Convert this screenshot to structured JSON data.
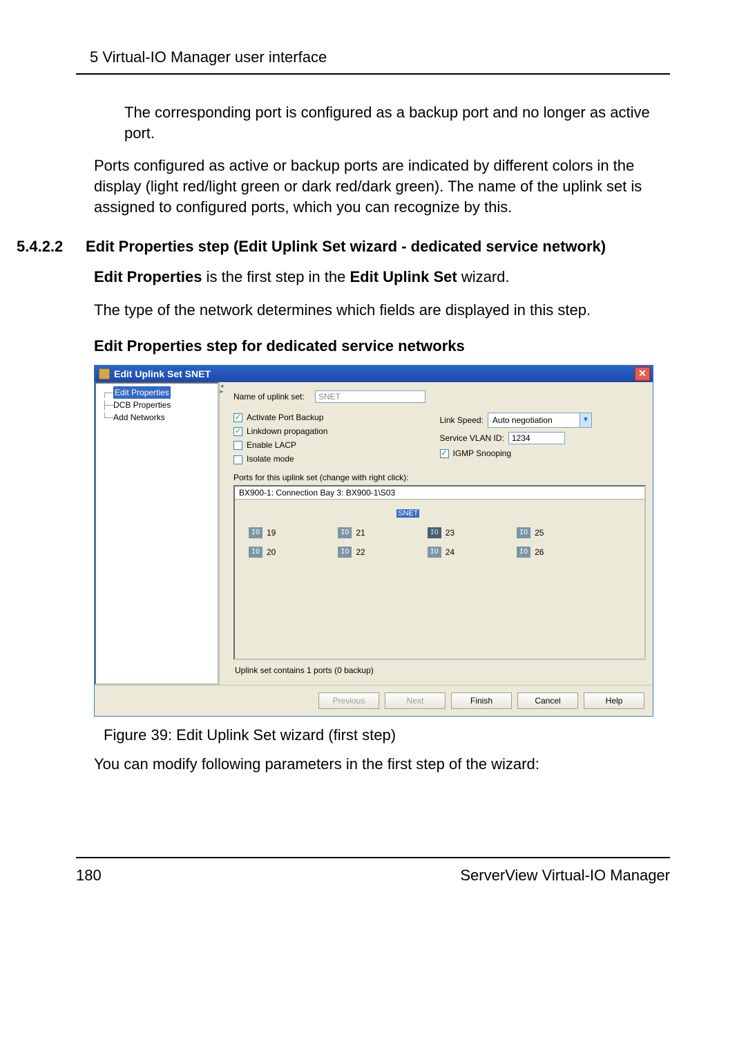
{
  "chapter_header": "5 Virtual-IO Manager user interface",
  "intro_para_1": "The corresponding port is configured as a backup port and no longer as active port.",
  "intro_para_2": "Ports configured as active or backup ports are indicated by different colors in the display (light red/light green or dark red/dark green). The name of the uplink set is assigned to configured ports, which you can recognize by this.",
  "section_number": "5.4.2.2",
  "section_title": "Edit Properties step (Edit Uplink Set wizard - dedicated service network)",
  "first_step_line_prefix": "Edit Properties",
  "first_step_line_mid": " is the first step in the ",
  "first_step_line_bold2": "Edit Uplink Set",
  "first_step_line_tail": " wizard.",
  "type_line": "The type of the network determines which fields are displayed in this step.",
  "sub_heading": "Edit Properties step for dedicated service networks",
  "win": {
    "title": "Edit Uplink Set SNET",
    "tree": {
      "items": [
        "Edit Properties",
        "DCB Properties",
        "Add Networks"
      ]
    },
    "main": {
      "name_label": "Name of uplink set:",
      "name_value": "SNET",
      "activate_port_backup": "Activate Port Backup",
      "linkdown_propagation": "Linkdown propagation",
      "enable_lacp": "Enable LACP",
      "isolate_mode": "Isolate mode",
      "link_speed_label": "Link Speed:",
      "link_speed_value": "Auto negotiation",
      "service_vlan_label": "Service VLAN ID:",
      "service_vlan_value": "1234",
      "igmp_snooping": "IGMP Snooping",
      "ports_label": "Ports for this uplink set (change with right click):",
      "ports_tab": "BX900-1: Connection Bay 3: BX900-1\\S03",
      "snet_badge": "SNET",
      "ports": [
        "19",
        "20",
        "21",
        "22",
        "23",
        "24",
        "25",
        "26"
      ],
      "io_label": "IO",
      "uplink_count": "Uplink set contains 1 ports (0 backup)"
    },
    "buttons": {
      "previous": "Previous",
      "next": "Next",
      "finish": "Finish",
      "cancel": "Cancel",
      "help": "Help"
    }
  },
  "figure_caption": "Figure 39: Edit Uplink Set wizard (first step)",
  "after_fig_para": "You can modify following parameters in the first step of the wizard:",
  "footer": {
    "page": "180",
    "product": "ServerView Virtual-IO Manager"
  }
}
